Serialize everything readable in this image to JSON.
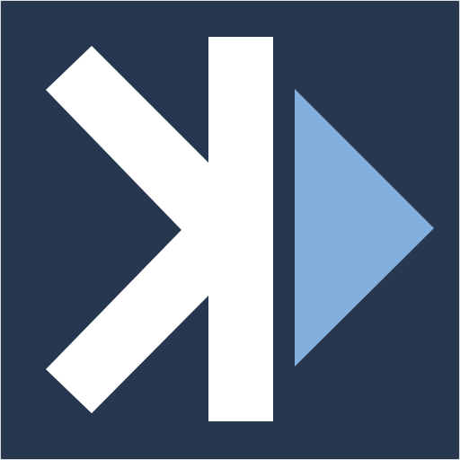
{
  "logo": {
    "icon_name": "kodi-style-k-play-logo",
    "colors": {
      "background": "#27374f",
      "border": "#d9dde3",
      "letter": "#ffffff",
      "play_triangle": "#84aedb"
    }
  }
}
